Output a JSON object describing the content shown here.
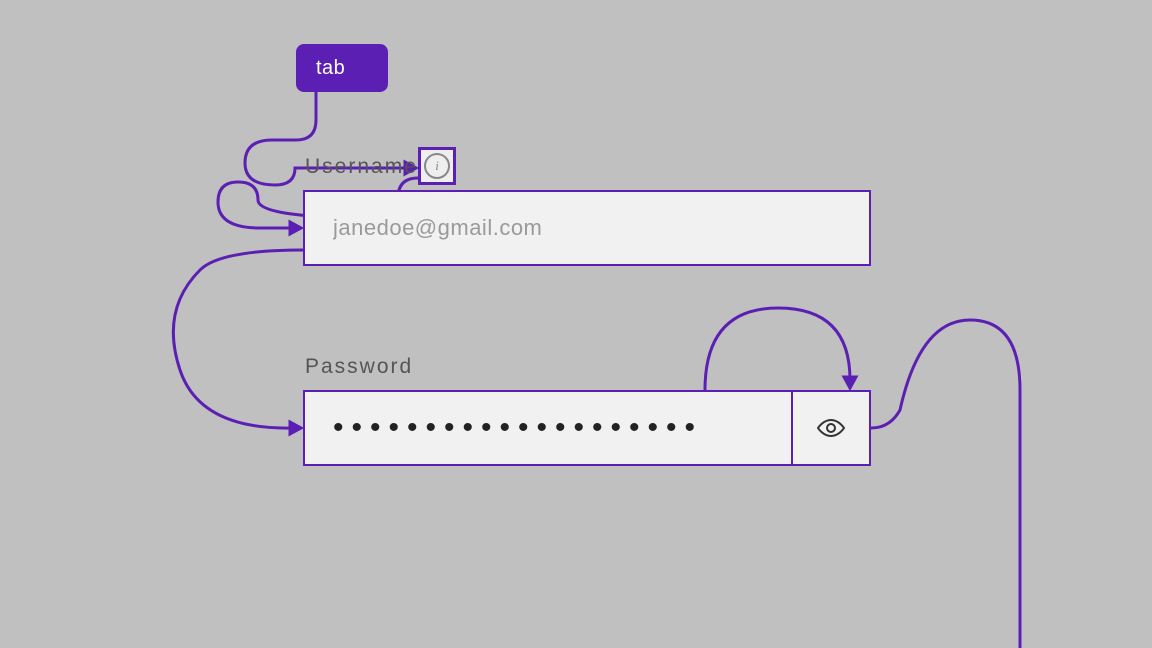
{
  "tab_key": {
    "label": "tab"
  },
  "username": {
    "label": "Username",
    "value": "janedoe@gmail.com"
  },
  "password": {
    "label": "Password",
    "mask": "••••••••••••••••••••"
  },
  "accent_color": "#5b20b3",
  "flow_description": "Tab → info tooltip → username field → password field → eye toggle → (continues)"
}
